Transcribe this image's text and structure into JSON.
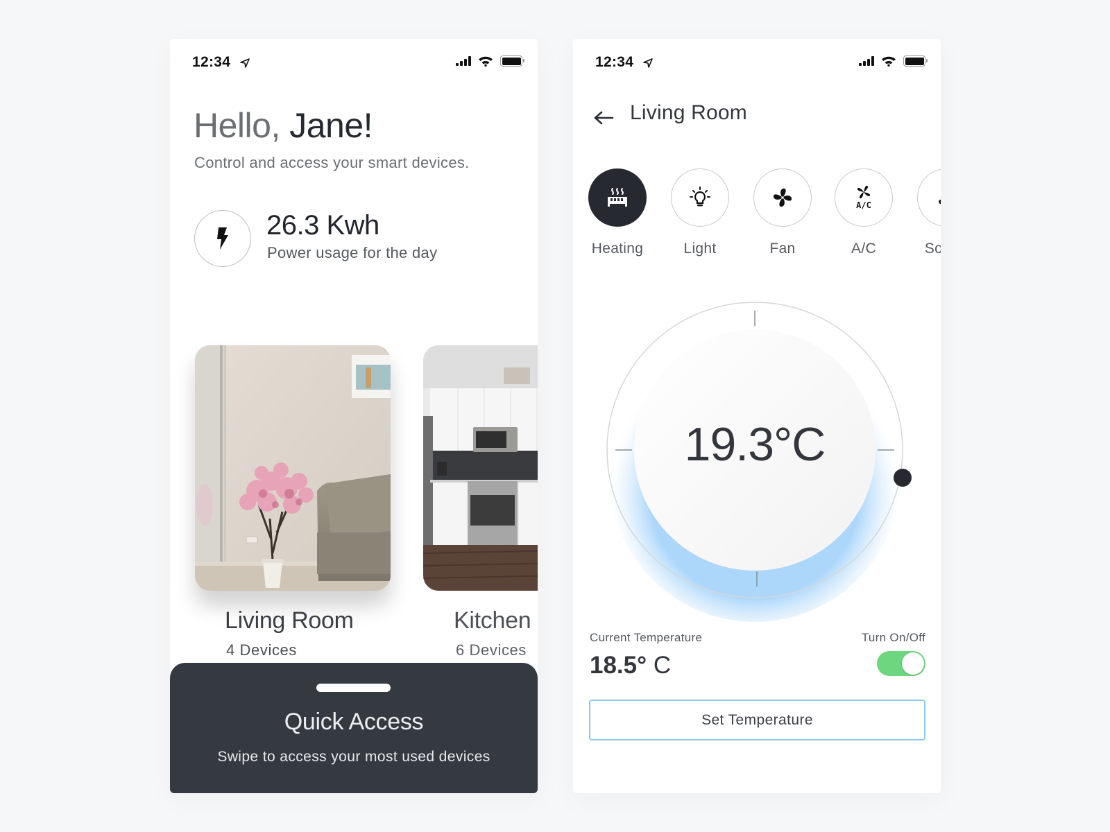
{
  "home_screen": {
    "status_bar": {
      "time": "12:34"
    },
    "greeting": {
      "hello": "Hello,",
      "name": " Jane!"
    },
    "subtitle": "Control and access your smart devices.",
    "power": {
      "icon": "lightning-bolt-icon",
      "value": "26.3 Kwh",
      "label": "Power usage for the day"
    },
    "rooms": [
      {
        "name": "Living Room",
        "devices": "4 Devices"
      },
      {
        "name": "Kitchen",
        "devices": "6 Devices"
      }
    ],
    "quick_access": {
      "title": "Quick Access",
      "subtitle": "Swipe to access your most used devices"
    }
  },
  "room_screen": {
    "status_bar": {
      "time": "12:34"
    },
    "title": "Living Room",
    "devices": [
      {
        "label": "Heating",
        "icon": "heater-icon",
        "active": true
      },
      {
        "label": "Light",
        "icon": "light-bulb-icon",
        "active": false
      },
      {
        "label": "Fan",
        "icon": "fan-icon",
        "active": false
      },
      {
        "label": "A/C",
        "icon": "air-conditioner-icon",
        "active": false
      },
      {
        "label": "Sound",
        "icon": "music-note-icon",
        "active": false
      }
    ],
    "dial": {
      "target_temp": "19.3°C"
    },
    "current_temperature": {
      "label": "Current Temperature",
      "value": "18.5°",
      "unit": " C"
    },
    "toggle": {
      "label": "Turn On/Off",
      "on": true
    },
    "set_button": "Set Temperature",
    "colors": {
      "accent_blue": "#8cc8f3",
      "toggle_green": "#6dd67e",
      "dark": "#262a30"
    }
  }
}
